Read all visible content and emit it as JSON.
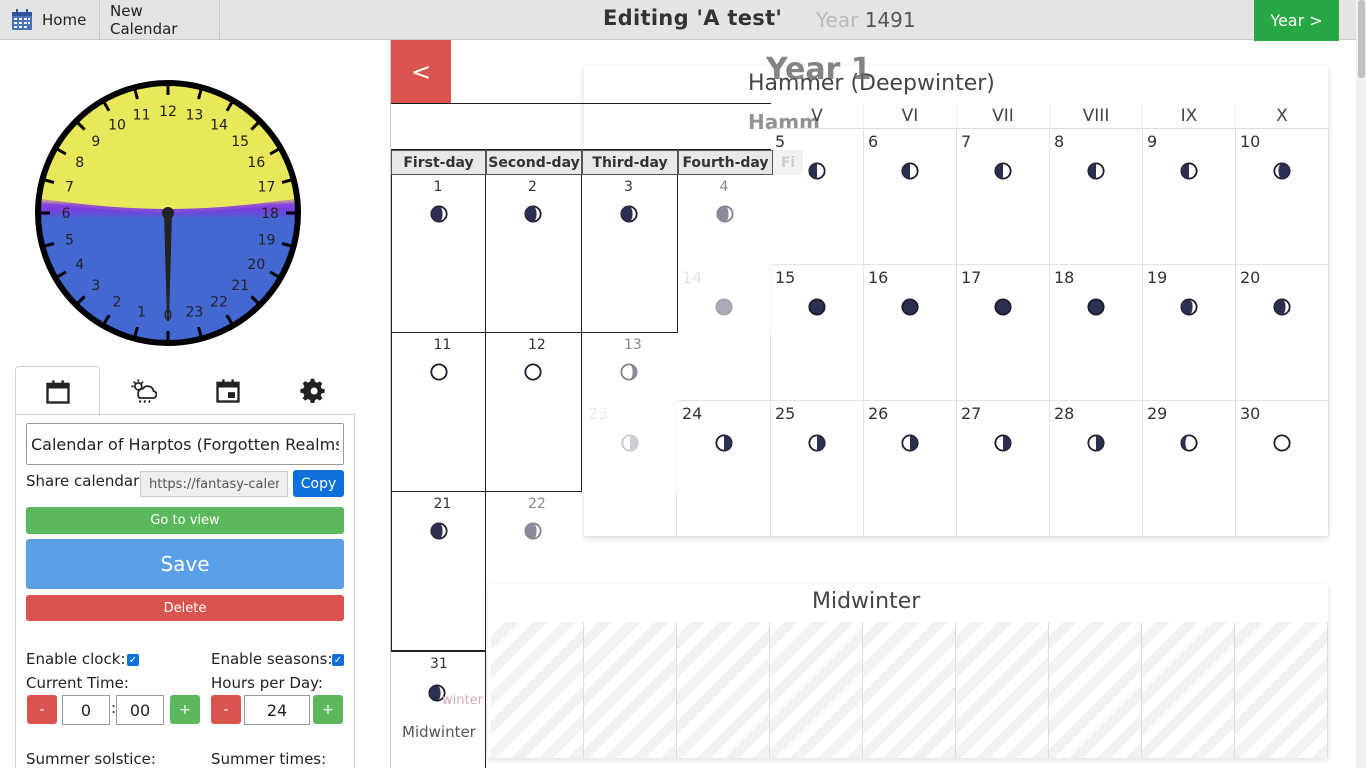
{
  "topbar": {
    "home_label": "Home",
    "new_calendar_label": "New Calendar",
    "editing_title": "Editing 'A test'",
    "year_label_prefix": "Year ",
    "year_number": "1491",
    "next_year_label": "Year >"
  },
  "clock": {
    "numbers": [
      "0",
      "1",
      "2",
      "3",
      "4",
      "5",
      "6",
      "7",
      "8",
      "9",
      "10",
      "11",
      "12",
      "13",
      "14",
      "15",
      "16",
      "17",
      "18",
      "19",
      "20",
      "21",
      "22",
      "23"
    ],
    "day_color": "#e9e85a",
    "night_color": "#4468d2",
    "dusk_color": "#7c3be0"
  },
  "tabs": [
    "calendar-icon",
    "weather-icon",
    "event-icon",
    "settings-icon"
  ],
  "settings": {
    "calendar_name": "Calendar of Harptos (Forgotten Realms)",
    "share_label": "Share calendar:",
    "share_url": "https://fantasy-calendar",
    "copy_label": "Copy",
    "go_to_view_label": "Go to view",
    "save_label": "Save",
    "delete_label": "Delete",
    "enable_clock_label": "Enable clock:",
    "enable_seasons_label": "Enable seasons:",
    "current_time_label": "Current Time:",
    "hours_per_day_label": "Hours per Day:",
    "hour_value": "0",
    "minute_value": "00",
    "hours_per_day_value": "24",
    "summer_solstice_label": "Summer solstice:",
    "summer_times_label": "Summer times:",
    "minus": "-",
    "plus": "+",
    "colon": ":"
  },
  "calendar": {
    "prev_label": "<",
    "year_overlay": "Year 1",
    "month_title": "Hammer (Deepwinter)",
    "month_ghost": "Hamm",
    "weekdays_roman": [
      "V",
      "VI",
      "VII",
      "VIII",
      "IX",
      "X"
    ],
    "weekdays_left": [
      "First-day",
      "Second-day",
      "Third-day",
      "Fourth-day",
      "Fi"
    ],
    "rows": [
      [
        "5",
        "6",
        "7",
        "8",
        "9",
        "10"
      ],
      [
        "15",
        "16",
        "17",
        "18",
        "19",
        "20"
      ],
      [
        "25",
        "26",
        "27",
        "28",
        "29",
        "30"
      ]
    ],
    "extra_days": {
      "fourteen": "14",
      "twentyfour": "24",
      "twentythree": "23"
    },
    "left_rows": [
      [
        "1",
        "2",
        "3",
        "4"
      ],
      [
        "11",
        "12",
        "13"
      ],
      [
        "21",
        "22"
      ],
      [
        "31"
      ]
    ],
    "midwinter_title": "Midwinter",
    "midwinter_label": "Midwinter",
    "midwinter_ghost": "winter"
  }
}
